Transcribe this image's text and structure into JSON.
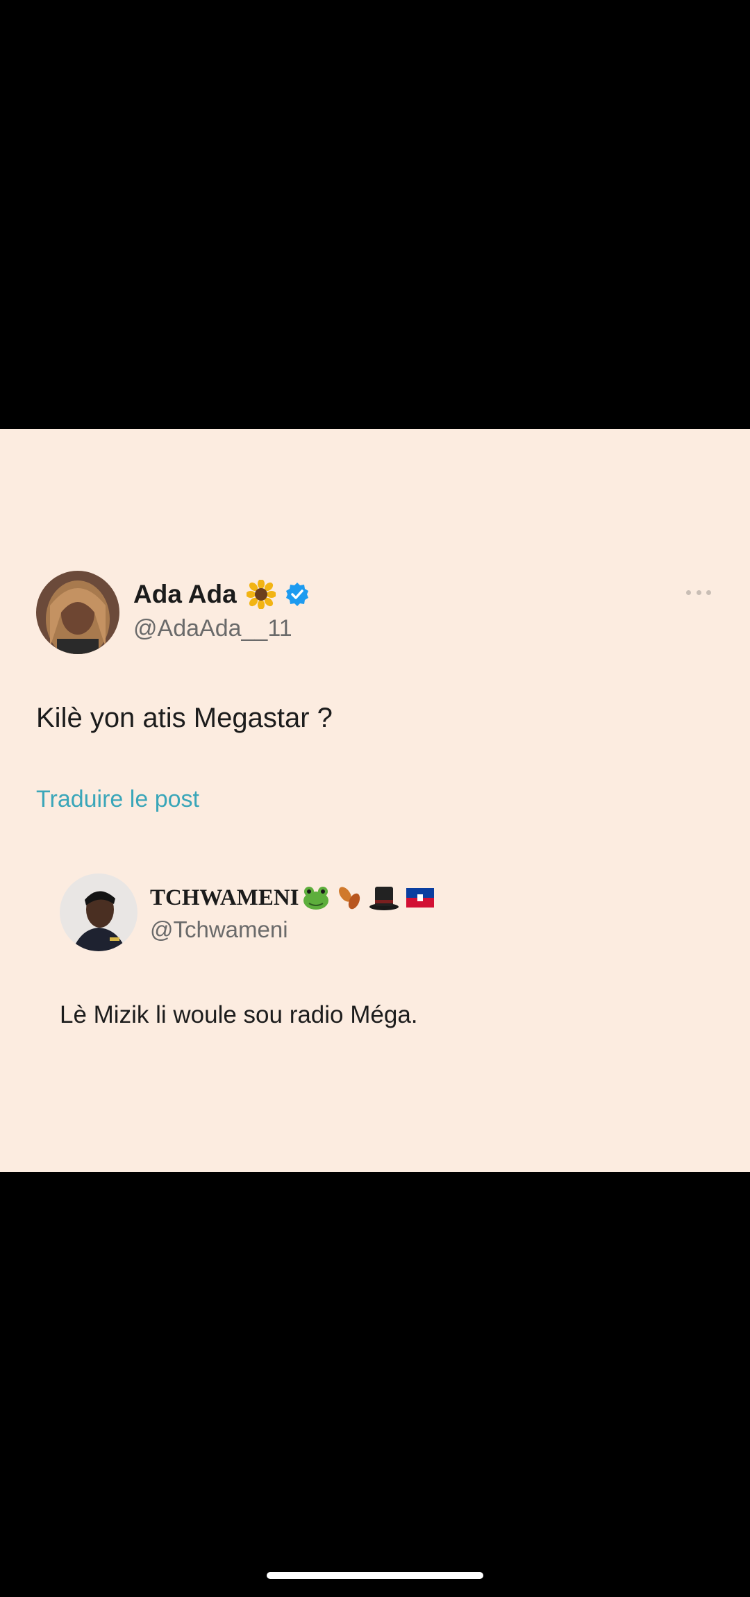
{
  "post": {
    "author_name": "Ada Ada",
    "author_handle": "@AdaAda__11",
    "author_emoji": "sunflower-icon",
    "verified": true,
    "text": "Kilè yon atis Megastar ?",
    "translate_label": "Traduire le post"
  },
  "reply": {
    "author_name": "TCHWAMENI",
    "author_emojis": [
      "frog-icon",
      "leaves-icon",
      "top-hat-icon",
      "haiti-flag-icon"
    ],
    "author_handle": "@Tchwameni",
    "text": "Lè Mizik li woule sou radio Méga."
  },
  "colors": {
    "background": "#000000",
    "card": "#fcece0",
    "verified_badge": "#1d9bf0",
    "link": "#3aa6b9"
  }
}
